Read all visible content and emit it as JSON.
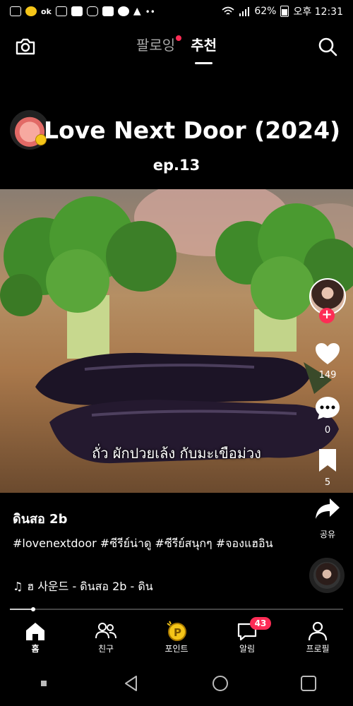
{
  "status_bar": {
    "battery_percent": "62%",
    "time": "오후 12:31",
    "icons": [
      "gallery-icon",
      "emoji-icon",
      "ok-app-icon",
      "message-icon",
      "mail-icon",
      "instagram-icon",
      "notification-count-icon",
      "kakaotalk-icon",
      "warning-icon",
      "more-dots-icon",
      "wifi-icon",
      "signal-icon",
      "battery-icon"
    ]
  },
  "top_nav": {
    "tabs": [
      {
        "label": "팔로잉",
        "active": false,
        "has_dot": true
      },
      {
        "label": "추천",
        "active": true
      }
    ]
  },
  "video": {
    "series_title": "Love Next Door (2024)",
    "episode": "ep.13",
    "subtitle": "ถั่ว ผักปวยเล้ง กับมะเขือม่วง"
  },
  "rail": {
    "like_count": "149",
    "comment_count": "0",
    "bookmark_count": "5",
    "share_label": "공유"
  },
  "caption": {
    "author": "ดินสอ 2b",
    "description": "#lovenextdoor #ซีรีย์น่าดู #ซีรีย์สนุกๆ #จองแฮอิน",
    "music": "ฮ 사운드 - ดินสอ 2b - ดิน"
  },
  "playback": {
    "progress": 0.07
  },
  "bottom_nav": {
    "items": [
      {
        "label": "홈"
      },
      {
        "label": "친구"
      },
      {
        "label": "포인트"
      },
      {
        "label": "알림",
        "badge": "43"
      },
      {
        "label": "프로필"
      }
    ]
  },
  "colors": {
    "accent": "#fe2c55",
    "background": "#000000"
  }
}
